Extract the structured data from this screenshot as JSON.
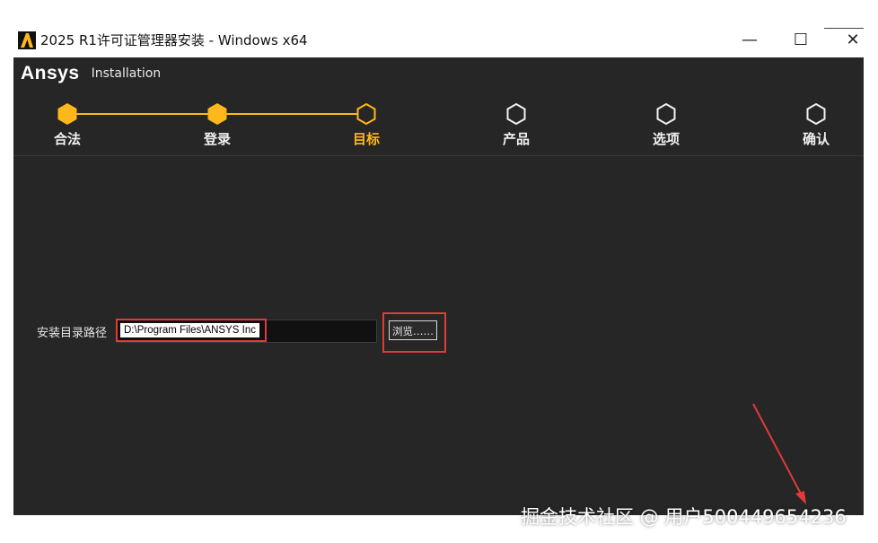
{
  "window": {
    "title": "2025 R1许可证管理器安装 - Windows x64",
    "controls": {
      "minimize": "—",
      "maximize": "☐",
      "close": "✕"
    }
  },
  "brand": {
    "logo": "Ansys",
    "subtitle": "Installation",
    "accent": "#ffb71b"
  },
  "steps": [
    {
      "label": "合法",
      "state": "done"
    },
    {
      "label": "登录",
      "state": "done"
    },
    {
      "label": "目标",
      "state": "current"
    },
    {
      "label": "产品",
      "state": "pending"
    },
    {
      "label": "选项",
      "state": "pending"
    },
    {
      "label": "确认",
      "state": "pending"
    }
  ],
  "install_dir": {
    "label": "安装目录路径",
    "value": "D:\\Program Files\\ANSYS Inc",
    "browse_label": "浏览……"
  },
  "watermark": "掘金技术社区 @ 用户500449654236"
}
